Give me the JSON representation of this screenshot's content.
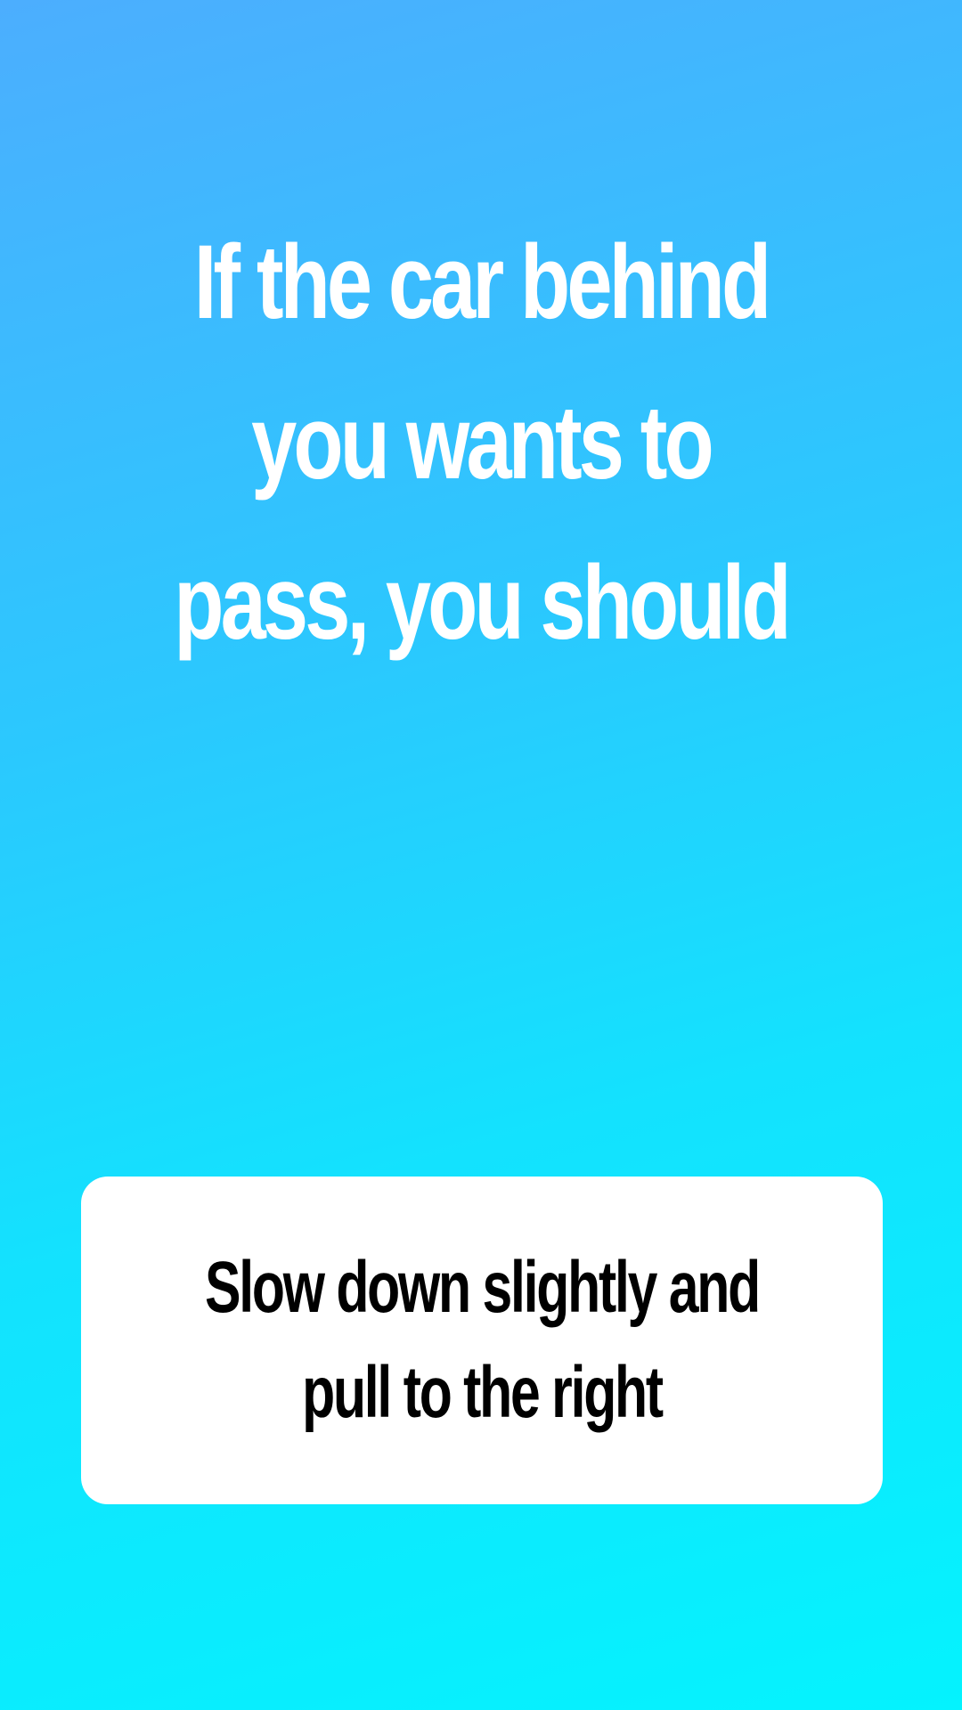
{
  "colors": {
    "background_top": "#4caefe",
    "background_bottom": "#04f3fe",
    "question_text": "#ffffff",
    "card_background": "#ffffff",
    "answer_text": "#000000"
  },
  "question": {
    "text": "If the car behind you wants to pass, you should"
  },
  "answer": {
    "text": "Slow down slightly and pull to the right"
  }
}
